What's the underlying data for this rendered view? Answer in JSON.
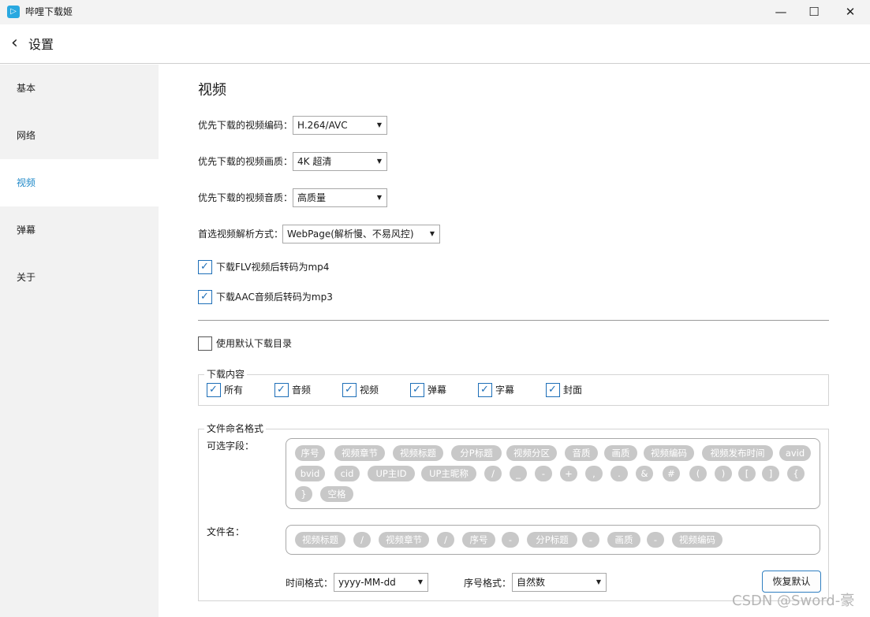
{
  "app": {
    "title": "哔哩下载姬",
    "logo": "▷"
  },
  "window_controls": {
    "minimize": "—",
    "maximize": "☐",
    "close": "✕"
  },
  "header": {
    "back_icon": "‹",
    "title": "设置"
  },
  "sidebar": {
    "items": [
      {
        "label": "基本",
        "active": false
      },
      {
        "label": "网络",
        "active": false
      },
      {
        "label": "视频",
        "active": true
      },
      {
        "label": "弹幕",
        "active": false
      },
      {
        "label": "关于",
        "active": false
      }
    ]
  },
  "video": {
    "section_title": "视频",
    "codec": {
      "label": "优先下载的视频编码：",
      "value": "H.264/AVC"
    },
    "quality": {
      "label": "优先下载的视频画质：",
      "value": "4K 超清"
    },
    "audio": {
      "label": "优先下载的视频音质：",
      "value": "高质量"
    },
    "parser": {
      "label": "首选视频解析方式：",
      "value": "WebPage(解析慢、不易风控)"
    },
    "flv_to_mp4": {
      "label": "下载FLV视频后转码为mp4",
      "checked": true
    },
    "aac_to_mp3": {
      "label": "下载AAC音频后转码为mp3",
      "checked": true
    },
    "default_dir": {
      "label": "使用默认下载目录",
      "checked": false
    }
  },
  "download_content": {
    "legend": "下载内容",
    "items": [
      {
        "label": "所有",
        "checked": true
      },
      {
        "label": "音频",
        "checked": true
      },
      {
        "label": "视频",
        "checked": true
      },
      {
        "label": "弹幕",
        "checked": true
      },
      {
        "label": "字幕",
        "checked": true
      },
      {
        "label": "封面",
        "checked": true
      }
    ]
  },
  "naming": {
    "legend": "文件命名格式",
    "available_label": "可选字段：",
    "available_fields": [
      "序号",
      "视频章节",
      "视频标题",
      "分P标题",
      "视频分区",
      "音质",
      "画质",
      "视频编码",
      "视频发布时间",
      "avid",
      "bvid",
      "cid",
      "UP主ID",
      "UP主昵称",
      "/",
      "_",
      "-",
      "+",
      ",",
      ".",
      "&",
      "#",
      "(",
      ")",
      "[",
      "]",
      "{",
      "}",
      "空格"
    ],
    "filename_label": "文件名：",
    "filename_fields": [
      "视频标题",
      "/",
      "视频章节",
      "/",
      "序号",
      "-",
      "分P标题",
      "-",
      "画质",
      "-",
      "视频编码"
    ],
    "time_format": {
      "label": "时间格式：",
      "value": "yyyy-MM-dd"
    },
    "seq_format": {
      "label": "序号格式：",
      "value": "自然数"
    },
    "reset_label": "恢复默认"
  },
  "watermark": "CSDN @Sword-豪",
  "colors": {
    "accent": "#1e88c8",
    "chip": "#c8c8c8",
    "sidebar_bg": "#f2f2f2"
  }
}
